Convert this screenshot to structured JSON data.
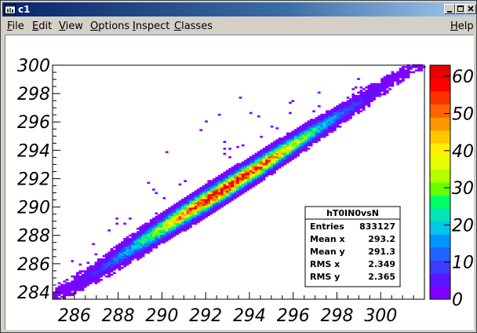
{
  "window": {
    "title": "c1",
    "controls": {
      "minimize": "minimize",
      "maximize": "maximize",
      "close": "close"
    }
  },
  "menu": {
    "items": [
      {
        "label": "File",
        "u": "F",
        "rest": "ile"
      },
      {
        "label": "Edit",
        "u": "E",
        "rest": "dit"
      },
      {
        "label": "View",
        "u": "V",
        "rest": "iew"
      },
      {
        "label": "Options",
        "u": "O",
        "rest": "ptions"
      },
      {
        "label": "Inspect",
        "u": "I",
        "rest": "nspect"
      },
      {
        "label": "Classes",
        "u": "C",
        "rest": "lasses"
      }
    ],
    "help": {
      "label": "Help",
      "u": "H",
      "rest": "elp"
    }
  },
  "colors": {
    "palette": [
      "#7f00ff",
      "#5a14ff",
      "#3c3cff",
      "#1e64ff",
      "#0096ff",
      "#00c8e6",
      "#00e6b4",
      "#00ff64",
      "#64ff00",
      "#b4ff00",
      "#e6ff00",
      "#fff000",
      "#ffc800",
      "#ff9600",
      "#ff6400",
      "#ff3200",
      "#ff0000",
      "#e60000"
    ]
  },
  "chart_data": {
    "type": "heatmap",
    "title": "",
    "xlabel": "",
    "ylabel": "",
    "xlim": [
      285,
      302
    ],
    "ylim": [
      283.5,
      300
    ],
    "x_ticks": [
      286,
      288,
      290,
      292,
      294,
      296,
      298,
      300
    ],
    "y_ticks": [
      284,
      286,
      288,
      290,
      292,
      294,
      296,
      298,
      300
    ],
    "z_range": [
      0,
      63
    ],
    "z_ticks": [
      0,
      10,
      20,
      30,
      40,
      50,
      60
    ],
    "band": {
      "description_points": [
        {
          "x": 285.0,
          "y_center": 283.7,
          "half_width": 0.35
        },
        {
          "x": 287.0,
          "y_center": 285.4,
          "half_width": 0.5
        },
        {
          "x": 289.0,
          "y_center": 287.5,
          "half_width": 0.7
        },
        {
          "x": 291.0,
          "y_center": 289.5,
          "half_width": 0.75
        },
        {
          "x": 293.0,
          "y_center": 291.4,
          "half_width": 0.75
        },
        {
          "x": 295.0,
          "y_center": 293.4,
          "half_width": 0.7
        },
        {
          "x": 297.0,
          "y_center": 295.4,
          "half_width": 0.6
        },
        {
          "x": 299.0,
          "y_center": 297.4,
          "half_width": 0.5
        },
        {
          "x": 301.5,
          "y_center": 299.9,
          "half_width": 0.3
        }
      ],
      "peak_x": 293.0,
      "peak_content": 60
    },
    "stats_box": {
      "name": "hT0IN0vsN",
      "rows": [
        {
          "label": "Entries",
          "value": "833127"
        },
        {
          "label": "Mean x",
          "value": "293.2"
        },
        {
          "label": "Mean y",
          "value": "291.3"
        },
        {
          "label": "RMS x",
          "value": "2.349"
        },
        {
          "label": "RMS y",
          "value": "2.365"
        }
      ]
    }
  }
}
